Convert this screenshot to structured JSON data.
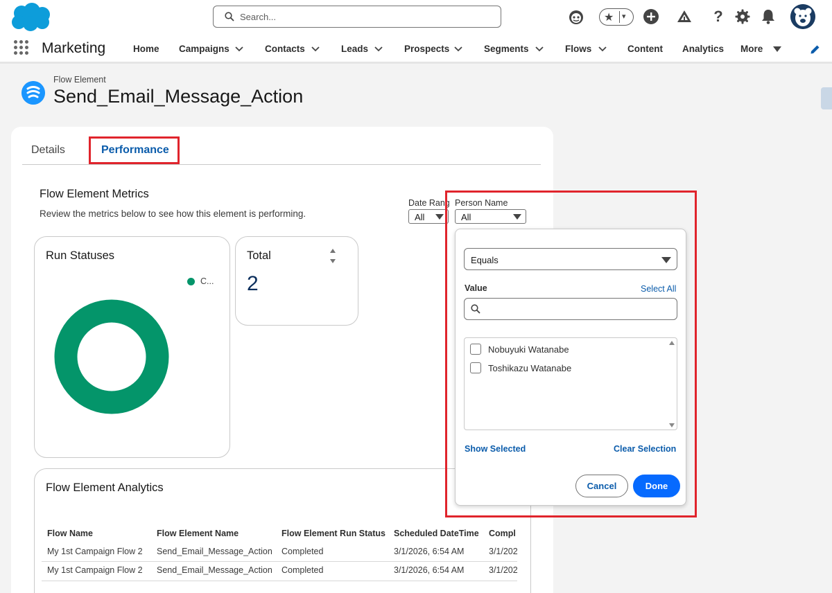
{
  "header": {
    "search_placeholder": "Search...",
    "favorites_star": "★",
    "favorites_caret": "▾",
    "help_glyph": "?"
  },
  "nav": {
    "app_name": "Marketing",
    "items": [
      {
        "label": "Home"
      },
      {
        "label": "Campaigns"
      },
      {
        "label": "Contacts"
      },
      {
        "label": "Leads"
      },
      {
        "label": "Prospects"
      },
      {
        "label": "Segments"
      },
      {
        "label": "Flows"
      },
      {
        "label": "Content"
      },
      {
        "label": "Analytics"
      },
      {
        "label": "More"
      }
    ]
  },
  "record": {
    "object_label": "Flow Element",
    "title": "Send_Email_Message_Action"
  },
  "tabs": {
    "details": "Details",
    "performance": "Performance"
  },
  "metrics": {
    "title": "Flow Element Metrics",
    "description": "Review the metrics below to see how this element is performing."
  },
  "filters": {
    "date_range": {
      "label": "Date Rang",
      "value": "All"
    },
    "person_name": {
      "label": "Person Name",
      "value": "All"
    }
  },
  "run_statuses": {
    "title": "Run Statuses",
    "legend": "C...",
    "color": "#04956a"
  },
  "total": {
    "title": "Total",
    "value": "2"
  },
  "analytics": {
    "title": "Flow Element Analytics",
    "columns": [
      "Flow Name",
      "Flow Element Name",
      "Flow Element Run Status",
      "Scheduled DateTime",
      "Compl"
    ],
    "rows": [
      [
        "My 1st Campaign Flow 2",
        "Send_Email_Message_Action",
        "Completed",
        "3/1/2026, 6:54 AM",
        "3/1/202"
      ],
      [
        "My 1st Campaign Flow 2",
        "Send_Email_Message_Action",
        "Completed",
        "3/1/2026, 6:54 AM",
        "3/1/202"
      ]
    ]
  },
  "filter_panel": {
    "operator": "Equals",
    "value_label": "Value",
    "select_all": "Select All",
    "search_value": "",
    "options": [
      {
        "label": "Nobuyuki Watanabe",
        "checked": false
      },
      {
        "label": "Toshikazu Watanabe",
        "checked": false
      }
    ],
    "show_selected": "Show Selected",
    "clear_selection": "Clear Selection",
    "cancel": "Cancel",
    "done": "Done"
  },
  "colors": {
    "accent": "#0b5cab",
    "brand": "#1b96ff",
    "highlight": "#e0242c",
    "donut": "#04956a"
  }
}
